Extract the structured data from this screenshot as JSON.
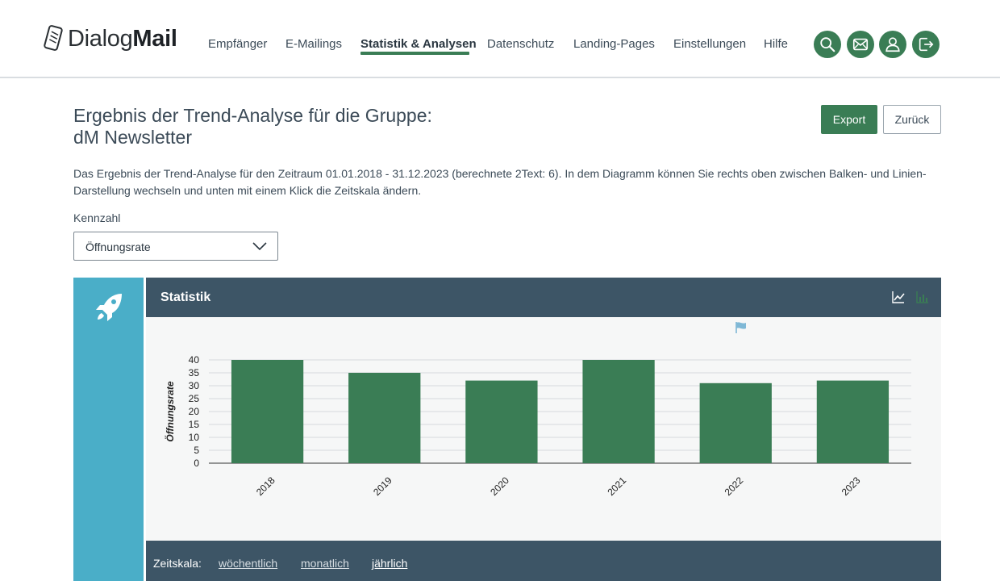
{
  "brand": {
    "name_light": "Dialog",
    "name_bold": "Mail"
  },
  "nav": {
    "items": [
      {
        "label": "Empfänger"
      },
      {
        "label": "E-Mailings"
      },
      {
        "label": "Statistik & Analysen",
        "active": true
      },
      {
        "label": "Datenschutz"
      },
      {
        "label": "Landing-Pages"
      },
      {
        "label": "Einstellungen"
      },
      {
        "label": "Hilfe"
      }
    ],
    "icon_buttons": [
      "search-icon",
      "mail-icon",
      "user-icon",
      "logout-icon"
    ]
  },
  "page": {
    "title_line1": "Ergebnis der Trend-Analyse für die Gruppe:",
    "title_line2": "dM Newsletter",
    "export_label": "Export",
    "back_label": "Zurück",
    "description": "Das Ergebnis der Trend-Analyse für den Zeitraum 01.01.2018 - 31.12.2023 (berechnete 2Text: 6). In dem Diagramm können Sie rechts oben zwischen Balken- und Linien-Darstellung wechseln und unten mit einem Klick die Zeitskala ändern.",
    "kennzahl_label": "Kennzahl",
    "kennzahl_value": "Öffnungsrate"
  },
  "widget": {
    "title": "Statistik",
    "side_icon": "rocket-icon",
    "header_icons": [
      "line-chart-icon",
      "bar-chart-icon"
    ],
    "zeitskala": {
      "label": "Zeitskala:",
      "options": [
        {
          "label": "wöchentlich"
        },
        {
          "label": "monatlich"
        },
        {
          "label": "jährlich",
          "active": true
        }
      ]
    }
  },
  "colors": {
    "primary_green": "#3a7d55",
    "header_dark": "#3d5566",
    "side_strip": "#4aaec8",
    "bar": "#3a7d55"
  },
  "chart_data": {
    "type": "bar",
    "categories": [
      "2018",
      "2019",
      "2020",
      "2021",
      "2022",
      "2023"
    ],
    "values": [
      40,
      35,
      32,
      40,
      31,
      32
    ],
    "ylabel": "Öffnungsrate",
    "ylim": [
      0,
      40
    ],
    "yticks": [
      0,
      5,
      10,
      15,
      20,
      25,
      30,
      35,
      40
    ],
    "grid": true
  }
}
